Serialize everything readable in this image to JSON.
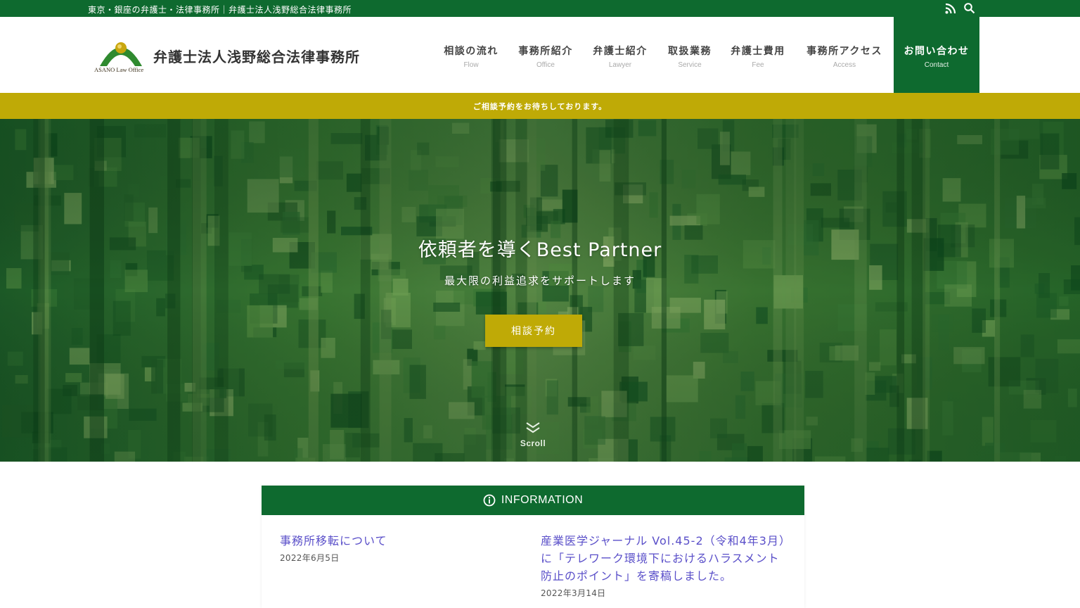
{
  "topbar": {
    "tagline": "東京・銀座の弁護士・法律事務所｜弁護士法人浅野総合法律事務所",
    "icons": [
      "rss-icon",
      "search-icon"
    ]
  },
  "logo": {
    "name": "弁護士法人浅野総合法律事務所",
    "mark_text": "ASANO Law Office"
  },
  "nav": [
    {
      "jp": "相談の流れ",
      "en": "Flow"
    },
    {
      "jp": "事務所紹介",
      "en": "Office"
    },
    {
      "jp": "弁護士紹介",
      "en": "Lawyer"
    },
    {
      "jp": "取扱業務",
      "en": "Service"
    },
    {
      "jp": "弁護士費用",
      "en": "Fee"
    },
    {
      "jp": "事務所アクセス",
      "en": "Access"
    },
    {
      "jp": "お問い合わせ",
      "en": "Contact"
    }
  ],
  "notice": "ご相談予約をお待ちしております。",
  "hero": {
    "title": "依頼者を導くBest Partner",
    "subtitle": "最大限の利益追求をサポートします",
    "cta": "相談予約",
    "scroll": "Scroll"
  },
  "information": {
    "heading": "INFORMATION",
    "items": [
      {
        "line1": "事務所移転について",
        "date": "2022年6月5日"
      },
      {
        "line1": "産業医学ジャーナル Vol.45-2（令和4年3月）",
        "line2": "に「テレワーク環境下におけるハラスメント",
        "line3": "防止のポイント」を寄稿しました。",
        "date": "2022年3月14日"
      }
    ]
  },
  "colors": {
    "brand_green": "#0e6a2f",
    "accent_gold": "#bfaa06",
    "link": "#5a4fc9"
  }
}
